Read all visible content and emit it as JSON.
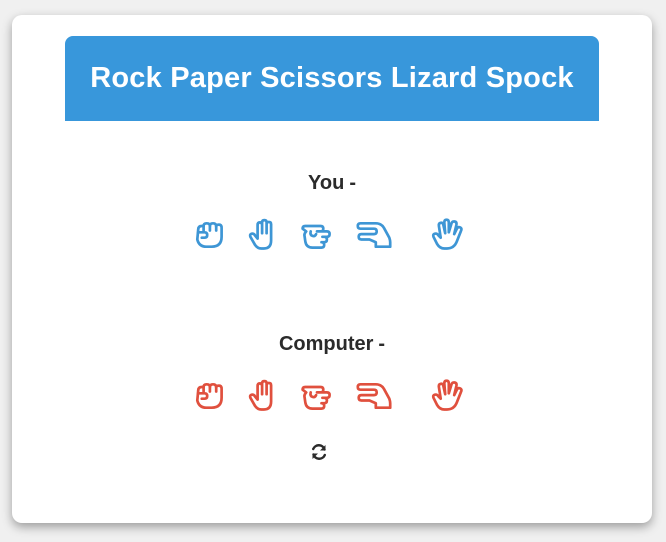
{
  "title": "Rock Paper Scissors Lizard Spock",
  "players": {
    "you": {
      "name": "You",
      "suffix": "-",
      "color": "#3e96d5"
    },
    "computer": {
      "name": "Computer",
      "suffix": "-",
      "color": "#e0503e"
    }
  },
  "choices": [
    {
      "id": "rock",
      "icon": "hand-rock-icon"
    },
    {
      "id": "paper",
      "icon": "hand-paper-icon"
    },
    {
      "id": "scissors",
      "icon": "hand-scissors-icon"
    },
    {
      "id": "lizard",
      "icon": "hand-lizard-icon"
    },
    {
      "id": "spock",
      "icon": "hand-spock-icon"
    }
  ],
  "reset": {
    "icon": "refresh-icon"
  },
  "colors": {
    "header": "#3897db",
    "background": "#f0f0f0",
    "card": "#ffffff"
  }
}
